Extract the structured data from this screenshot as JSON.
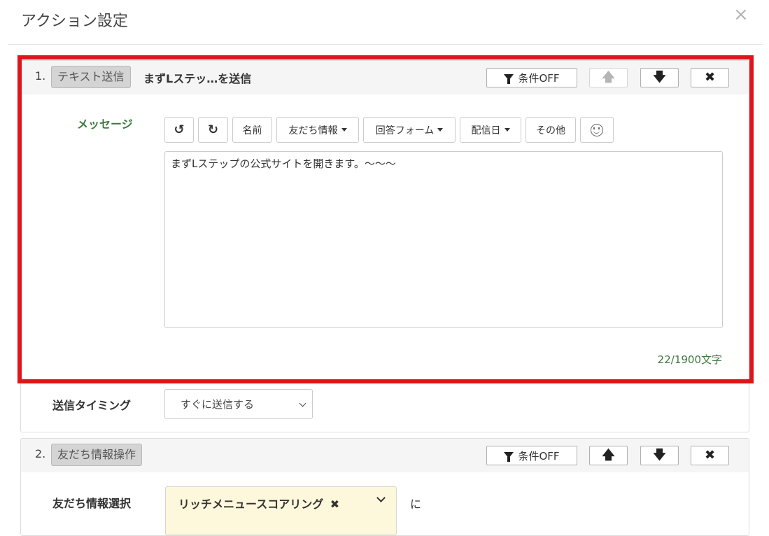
{
  "modal": {
    "title": "アクション設定",
    "close_glyph": "×"
  },
  "actions": [
    {
      "index": "1.",
      "type_tag": "テキスト送信",
      "name": "まずLステッ…を送信",
      "condition_label": "条件OFF",
      "message_label": "メッセージ",
      "toolbar": {
        "undo_icon": "undo-icon",
        "redo_icon": "redo-icon",
        "name_label": "名前",
        "friend_info_label": "友だち情報",
        "answer_form_label": "回答フォーム",
        "delivery_date_label": "配信日",
        "other_label": "その他",
        "emoji_icon": "smiley-icon"
      },
      "message_text": "まずLステップの公式サイトを開きます。〜〜〜",
      "char_count": "22/1900文字",
      "timing_label": "送信タイミング",
      "timing_value": "すぐに送信する"
    },
    {
      "index": "2.",
      "type_tag": "友だち情報操作",
      "condition_label": "条件OFF",
      "field_label": "友だち情報選択",
      "selected_field": "リッチメニュースコアリング",
      "suffix": "に"
    }
  ],
  "glyphs": {
    "up": "🡅",
    "down": "🡇",
    "delete": "✖",
    "undo": "↺",
    "redo": "↻"
  },
  "colors": {
    "highlight_frame": "#e0141b",
    "label_green": "#3c7a3c",
    "selected_chip_bg": "#fdf8dc"
  }
}
